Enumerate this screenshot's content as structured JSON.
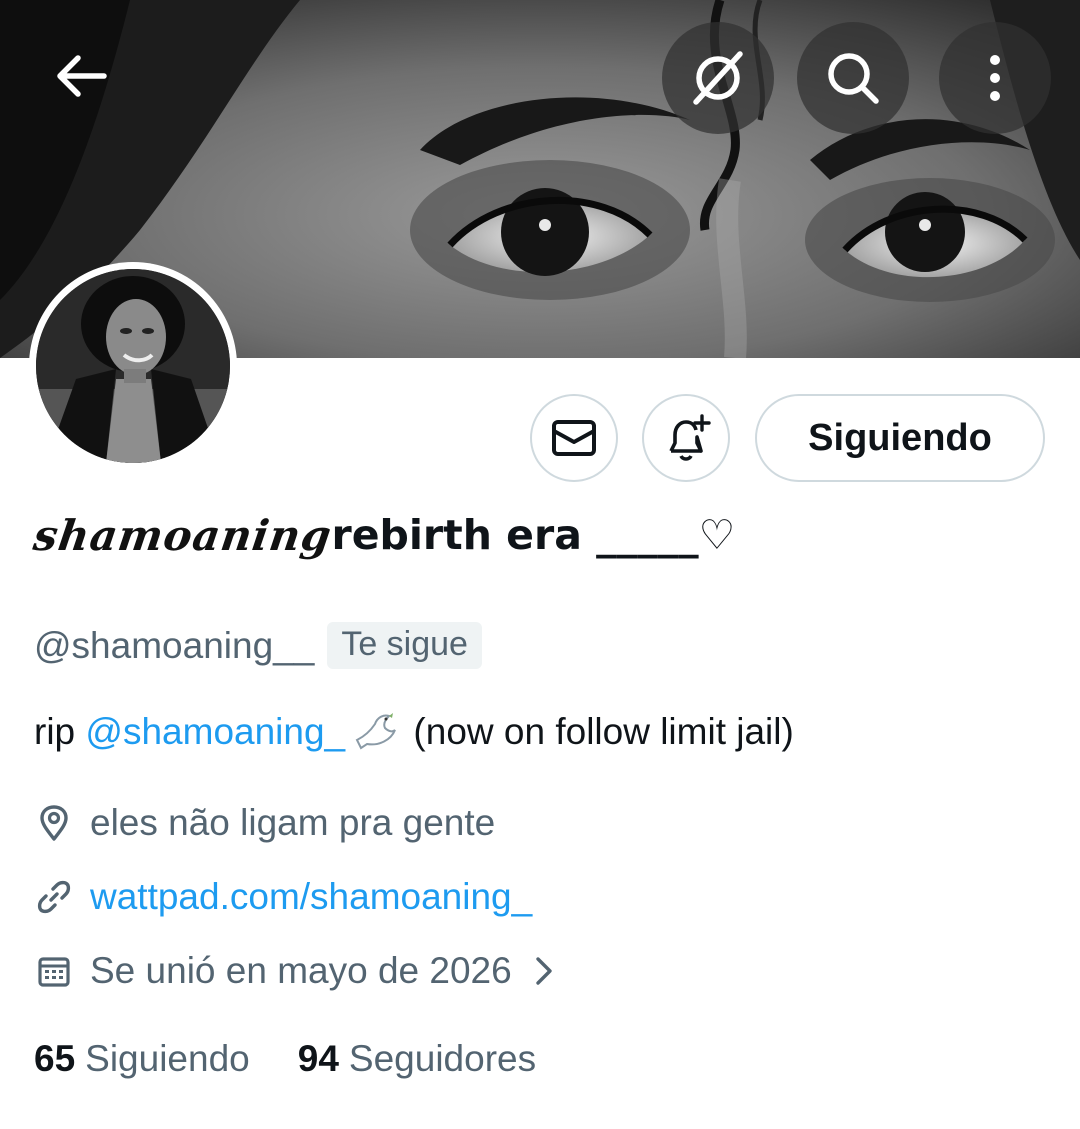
{
  "header": {
    "back_icon": "arrow-left-icon",
    "grok_icon": "slashed-circle-icon",
    "search_icon": "search-icon",
    "more_icon": "more-vertical-icon"
  },
  "profile": {
    "display_name_script": "shamoaning",
    "display_name_rest": "rebirth era _____♡",
    "handle": "@shamoaning__",
    "follows_you_badge": "Te sigue",
    "bio_prefix": "rip ",
    "bio_mention": "@shamoaning_",
    "bio_suffix": " (now on follow limit jail)",
    "location": "eles não ligam pra gente",
    "website": "wattpad.com/shamoaning_",
    "joined": "Se unió en mayo de 2026"
  },
  "actions": {
    "message_icon": "envelope-icon",
    "notify_icon": "bell-plus-icon",
    "follow_button_label": "Siguiendo"
  },
  "stats": {
    "following_count": "65",
    "following_label": "Siguiendo",
    "followers_count": "94",
    "followers_label": "Seguidores"
  },
  "colors": {
    "link": "#1d9bf0",
    "secondary_text": "#536471",
    "primary_text": "#0f1419",
    "border": "#cfd9de"
  }
}
